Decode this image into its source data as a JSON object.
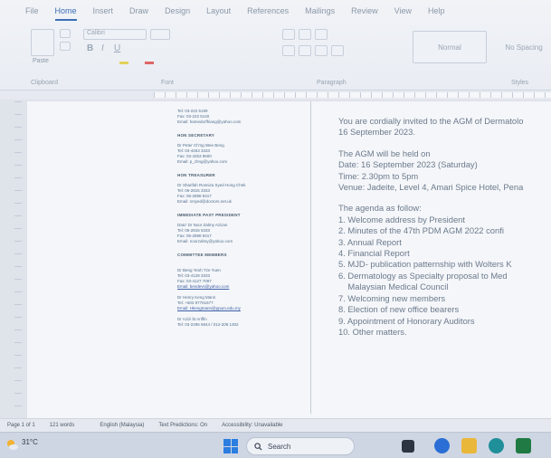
{
  "ribbon": {
    "tabs": [
      "File",
      "Home",
      "Insert",
      "Draw",
      "Design",
      "Layout",
      "References",
      "Mailings",
      "Review",
      "View",
      "Help"
    ],
    "active_tab": "Home",
    "font_name": "Calibri",
    "groups": [
      "Clipboard",
      "Font",
      "Paragraph",
      "Styles"
    ],
    "styles": [
      "Normal",
      "No Spacing"
    ],
    "paste_label": "Paste"
  },
  "left_col": {
    "top": [
      "Tel: 03-222 5199",
      "Fax: 03-222 5140",
      "Email: hamedorfhiang@yahoo.com"
    ],
    "sections": [
      {
        "title": "HON SECRETARY",
        "lines": [
          {
            "t": "Dr Peter Ch'ng Wee Beng",
            "link": false
          },
          {
            "t": "Tel: 03-4253 3333",
            "link": false
          },
          {
            "t": "Fax: 03-4253 9600",
            "link": false
          },
          {
            "t": "Email: p_chng@yahoo.com",
            "link": false
          }
        ]
      },
      {
        "title": "HON TREASURER",
        "lines": [
          {
            "t": "Dr Sharifah Rosniza Syed Hong Chek",
            "link": false
          },
          {
            "t": "Tel: 06-2815 3333",
            "link": false
          },
          {
            "t": "Fax: 06-2898 9417",
            "link": false
          },
          {
            "t": "Email: srsyed@doctors.net.uk",
            "link": false
          }
        ]
      },
      {
        "title": "IMMEDIATE PAST PRESIDENT",
        "lines": [
          {
            "t": "Dato' Dr Noor Zalmy Azizan",
            "link": false
          },
          {
            "t": "Tel: 05-2815 5333",
            "link": false
          },
          {
            "t": "Fax: 05-2898 9417",
            "link": false
          },
          {
            "t": "Email: noorzalmy@yahoo.com",
            "link": false
          }
        ]
      },
      {
        "title": "COMMITTEE MEMBERS",
        "lines": [
          {
            "t": "",
            "link": false
          },
          {
            "t": "Dr Beng Yeoh Tze Yuen",
            "link": false
          },
          {
            "t": "Tel: 03-4128 3333",
            "link": false
          },
          {
            "t": "Fax: 03-4127 7097",
            "link": false
          },
          {
            "t": "Email: bendevs@yahoo.com",
            "link": true
          },
          {
            "t": "",
            "link": false
          },
          {
            "t": "Dr Henry Keng Mann",
            "link": false
          },
          {
            "t": "Tel: +603 97751677",
            "link": false
          },
          {
            "t": "Email: Hkengmann@ppum.edu.my",
            "link": true
          },
          {
            "t": "",
            "link": false
          },
          {
            "t": "Dr Azizi bt Ariffin",
            "link": false
          },
          {
            "t": "Tel: 03-2296 6944 / 012-208 1302",
            "link": false
          }
        ]
      }
    ]
  },
  "right_col": {
    "para1": [
      "You are cordially invited to the AGM of Dermatolo",
      "16 September 2023."
    ],
    "para2": [
      "The AGM will be held on",
      "Date: 16 September 2023 (Saturday)",
      "Time: 2.30pm to 5pm",
      "Venue: Jadeite, Level 4, Amari Spice Hotel, Pena"
    ],
    "agenda_intro": "The agenda as follow:",
    "agenda": [
      "1. Welcome address by President",
      "2. Minutes of the 47th PDM AGM 2022 confi",
      "3. Annual Report",
      "4. Financial Report",
      "5. MJD- publication patternship with Wolters K",
      "6. Dermatology as Specialty proposal to Med",
      "    Malaysian Medical Council",
      "7. Welcoming new members",
      "8. Election of new office bearers",
      "9. Appointment of Honorary Auditors",
      "10. Other matters."
    ]
  },
  "status": {
    "page": "Page 1 of 1",
    "words": "121 words",
    "language": "English (Malaysia)",
    "predictions": "Text Predictions: On",
    "accessibility": "Accessibility: Unavailable"
  },
  "taskbar": {
    "temperature": "31°C",
    "search_label": "Search"
  }
}
